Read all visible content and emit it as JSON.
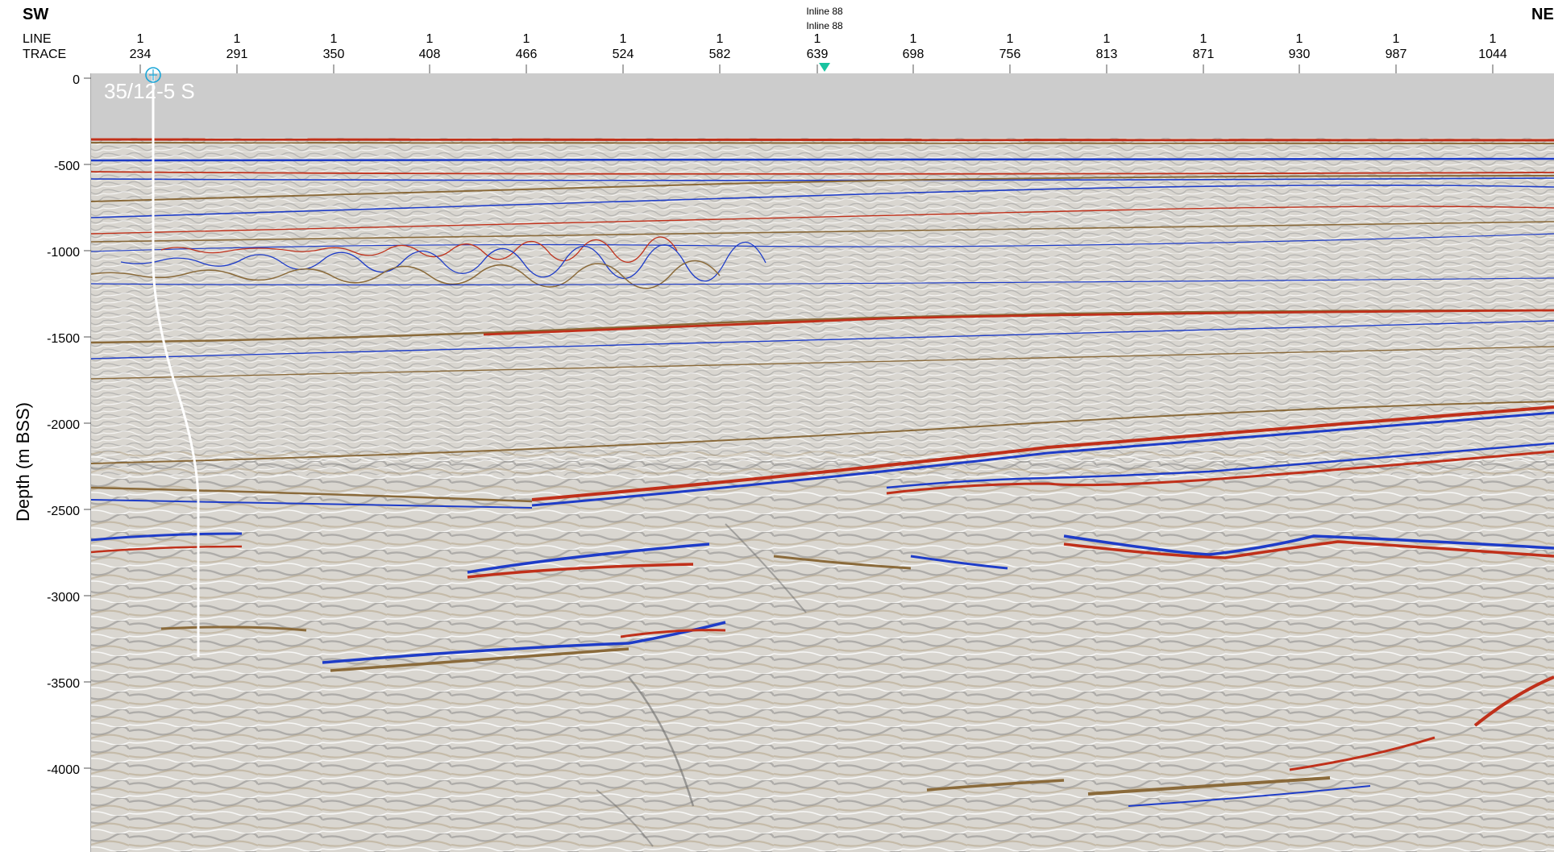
{
  "header": {
    "left_direction": "SW",
    "right_direction": "NE",
    "row_labels": [
      "LINE",
      "TRACE"
    ],
    "inline_labels": [
      "Inline 88",
      "Inline 88"
    ]
  },
  "traces": [
    {
      "line": "1",
      "trace": "234"
    },
    {
      "line": "1",
      "trace": "291"
    },
    {
      "line": "1",
      "trace": "350"
    },
    {
      "line": "1",
      "trace": "408"
    },
    {
      "line": "1",
      "trace": "466"
    },
    {
      "line": "1",
      "trace": "524"
    },
    {
      "line": "1",
      "trace": "582"
    },
    {
      "line": "1",
      "trace": "639"
    },
    {
      "line": "1",
      "trace": "698"
    },
    {
      "line": "1",
      "trace": "756"
    },
    {
      "line": "1",
      "trace": "813"
    },
    {
      "line": "1",
      "trace": "871"
    },
    {
      "line": "1",
      "trace": "930"
    },
    {
      "line": "1",
      "trace": "987"
    },
    {
      "line": "1",
      "trace": "1044"
    }
  ],
  "depth_axis": {
    "title": "Depth (m BSS)",
    "ticks": [
      "0",
      "-500",
      "-1000",
      "-1500",
      "-2000",
      "-2500",
      "-3000",
      "-3500",
      "-4000"
    ]
  },
  "well": {
    "name": "35/12-5 S",
    "total_depth_m": -3400
  },
  "colors": {
    "water": "#cccccc",
    "positive_reflector": "#c0301a",
    "negative_reflector": "#1e3cc8",
    "brown_reflector": "#8a6a3a",
    "well_path": "#ffffff",
    "well_symbol": "#1aa6d8",
    "inline_marker": "#19c3a0"
  }
}
